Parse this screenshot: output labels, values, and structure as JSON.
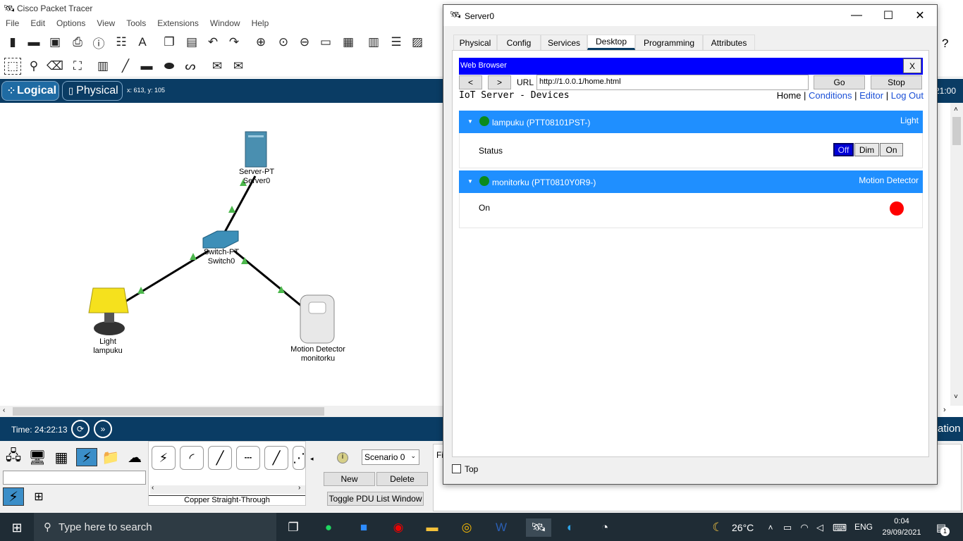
{
  "main_window": {
    "title": "Cisco Packet Tracer",
    "menu": [
      "File",
      "Edit",
      "Options",
      "View",
      "Tools",
      "Extensions",
      "Window",
      "Help"
    ]
  },
  "mode_bar": {
    "logical": "Logical",
    "physical": "Physical",
    "coords": "x: 613, y: 105",
    "clock_fragment": "21:00"
  },
  "topology": {
    "server": {
      "type": "Server-PT",
      "name": "Server0"
    },
    "switch": {
      "type": "Switch-PT",
      "name": "Switch0"
    },
    "light": {
      "type": "Light",
      "name": "lampuku"
    },
    "motion": {
      "type": "Motion Detector",
      "name": "monitorku"
    }
  },
  "time_bar": {
    "time": "Time: 24:22:13",
    "right_fragment": "ation"
  },
  "bottom_panel": {
    "scenario": "Scenario 0",
    "new_button": "New",
    "delete_button": "Delete",
    "toggle_button": "Toggle PDU List Window",
    "cable_label": "Copper Straight-Through",
    "fire_fragment": "Fi"
  },
  "dialog": {
    "title": "Server0",
    "tabs": [
      "Physical",
      "Config",
      "Services",
      "Desktop",
      "Programming",
      "Attributes"
    ],
    "active_tab": "Desktop",
    "top_checkbox_label": "Top"
  },
  "web_browser": {
    "title": "Web Browser",
    "close": "X",
    "back": "<",
    "forward": ">",
    "url_label": "URL",
    "url": "http://1.0.0.1/home.html",
    "go": "Go",
    "stop": "Stop"
  },
  "iot_page": {
    "title": "IoT Server - Devices",
    "nav": {
      "home": "Home",
      "sep": "|",
      "conditions": "Conditions",
      "editor": "Editor",
      "logout": "Log Out"
    },
    "devices": [
      {
        "name": "lampuku (PTT08101PST-)",
        "type": "Light",
        "field": "Status",
        "options": [
          "Off",
          "Dim",
          "On"
        ],
        "selected": "Off",
        "status_color": "#0a8a1c"
      },
      {
        "name": "monitorku (PTT0810Y0R9-)",
        "type": "Motion Detector",
        "field": "On",
        "indicator_color": "#ff0000",
        "status_color": "#0a8a1c"
      }
    ]
  },
  "taskbar": {
    "search_placeholder": "Type here to search",
    "temperature": "26°C",
    "language": "ENG",
    "time": "0:04",
    "date": "29/09/2021",
    "notification_count": "1"
  },
  "colors": {
    "mode_bar": "#0a3c64",
    "wb_header": "#0000ff",
    "device_header": "#1f8fff",
    "taskbar": "#1f2c35"
  }
}
